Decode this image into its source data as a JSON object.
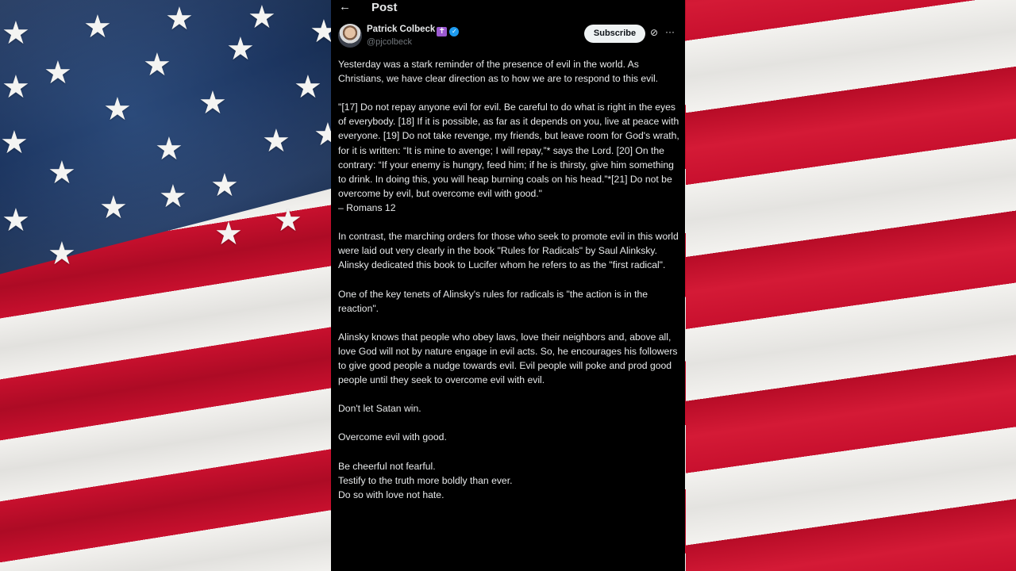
{
  "header": {
    "back_icon": "arrow-left-icon",
    "title": "Post"
  },
  "author": {
    "name": "Patrick Colbeck",
    "badge_icon": "latin-cross-icon",
    "verified_icon": "verified-badge-icon",
    "handle": "@pjcolbeck",
    "subscribe_label": "Subscribe",
    "grok_icon": "grok-icon",
    "more_icon": "more-horizontal-icon"
  },
  "post": {
    "paragraphs": [
      "Yesterday was a stark reminder of the presence of evil in the world.  As Christians, we have clear direction as to how we are to respond to this evil.",
      "\"[17] Do not repay anyone evil for evil. Be careful to do what is right in the eyes of everybody. [18] If it is possible, as far as it depends on you, live at peace with everyone. [19] Do not take revenge, my friends, but leave room for God's wrath, for it is written: “It is mine to avenge; I will repay,”* says the Lord. [20] On the contrary: “If your enemy is hungry, feed him; if he is thirsty, give him something to drink. In doing this, you will heap burning coals on his head.”*[21] Do not be overcome by evil, but overcome evil with good.\"",
      "– Romans 12",
      "In contrast, the marching orders for those who seek to promote evil in this world were laid out very clearly in the book \"Rules for Radicals\" by Saul Alinksky.  Alinsky dedicated this book to Lucifer whom he refers to as the \"first radical\".",
      "One of the key tenets of Alinsky's rules for radicals is \"the action is in the reaction\".",
      "Alinsky knows that people who obey laws, love their neighbors and, above all, love God will not by nature engage in evil acts.  So, he encourages his followers to give good people a nudge towards evil.  Evil people will poke and prod good people until they seek to overcome evil with evil.",
      "Don't let Satan win.",
      "Overcome evil with good.",
      "Be cheerful not fearful.",
      "Testify to the truth more boldly than ever.",
      "Do so with love not hate."
    ]
  },
  "background": {
    "flag_red": "#c8102e",
    "flag_white": "#f1f0ee",
    "flag_blue": "#1c3560"
  }
}
